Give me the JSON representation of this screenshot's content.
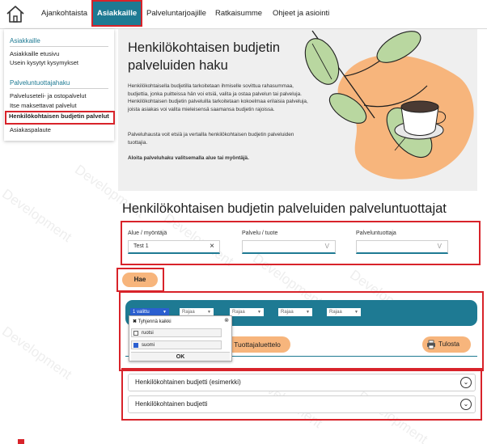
{
  "nav": {
    "items": [
      {
        "label": "Ajankohtaista"
      },
      {
        "label": "Asiakkaille"
      },
      {
        "label": "Palveluntarjoajille"
      },
      {
        "label": "Ratkaisumme"
      },
      {
        "label": "Ohjeet ja asiointi"
      }
    ]
  },
  "menu": {
    "section1": "Asiakkaille",
    "links1": [
      "Asiakkaille etusivu",
      "Usein kysytyt kysymykset"
    ],
    "section2": "Palveluntuottajahaku",
    "links2": [
      "Palveluseteli- ja ostopalvelut",
      "Itse maksettavat palvelut",
      "Henkilökohtaisen budjetin palvelut",
      "Asiakaspalaute"
    ]
  },
  "hero": {
    "title": "Henkilökohtaisen budjetin palveluiden haku",
    "p1": "Henkilökohtaisella budjetilla tarkoitetaan ihmiselle sovittua rahasummaa, budjettia, jonka puitteissa hän voi etsiä, valita ja ostaa palvelun tai palveluja. Henkilökohtaisen budjetin palveluilla tarkoitetaan kokoelmaa erilaisia palveluja, joista asiakas voi valita mieleisensä saamansa budjetin rajoissa.",
    "p2": "Palveluhausta voit etsiä ja vertailla henkilökohtaisen budjetin palveluiden tuottajia.",
    "p3": "Aloita palveluhaku valitsemalla alue tai myöntäjä."
  },
  "section_title": "Henkilökohtaisen budjetin palveluiden palveluntuottajat",
  "filters": {
    "area_label": "Alue / myöntäjä",
    "area_value": "Test 1",
    "area_clear": "×",
    "service_label": "Palvelu / tuote",
    "provider_label": "Palveluntuottaja",
    "chevron": "V"
  },
  "search_button": "Hae",
  "results": {
    "select_first": "1 valittu",
    "selects": [
      "Rajaa",
      "Rajaa",
      "Rajaa",
      "Rajaa"
    ],
    "popup": {
      "clear_all": "Tyhjennä kaikki",
      "options": [
        {
          "label": "ruotsi",
          "checked": false
        },
        {
          "label": "suomi",
          "checked": true
        }
      ],
      "ok": "OK"
    },
    "list_button": "Tuottajaluettelo",
    "print_button": "Tulosta"
  },
  "accordions": [
    {
      "title": "Henkilökohtainen budjetti (esimerkki)"
    },
    {
      "title": "Henkilökohtainen budjetti"
    }
  ],
  "watermark": "Development",
  "colors": {
    "accent": "#1e7a93",
    "orange": "#f7b57c",
    "highlight": "#d8232a",
    "hero_bg": "#efefef"
  }
}
